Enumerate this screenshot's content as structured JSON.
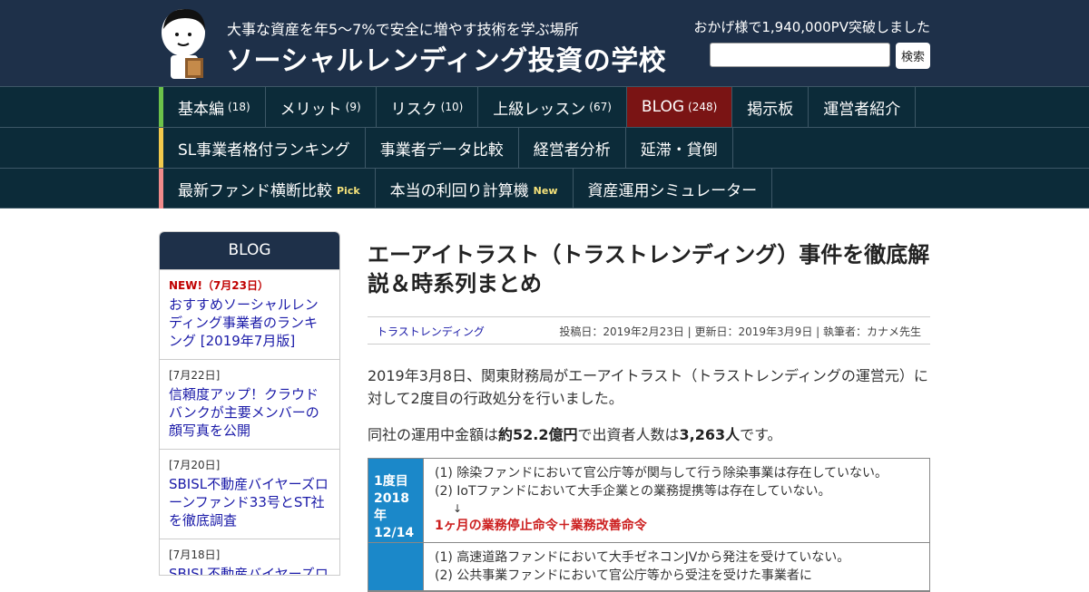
{
  "header": {
    "tagline": "大事な資産を年5～7%で安全に増やす技術を学ぶ場所",
    "site_title": "ソーシャルレンディング投資の学校",
    "pv_note": "おかげ様で1,940,000PV突破しました",
    "search_placeholder": "",
    "search_button": "検索",
    "mascot_icon": "teacher-mascot-icon"
  },
  "nav": {
    "row1": [
      {
        "label": "基本編",
        "count": "(18)"
      },
      {
        "label": "メリット",
        "count": "(9)"
      },
      {
        "label": "リスク",
        "count": "(10)"
      },
      {
        "label": "上級レッスン",
        "count": "(67)"
      },
      {
        "label": "BLOG",
        "count": "(248)",
        "active": true
      },
      {
        "label": "掲示板",
        "count": ""
      },
      {
        "label": "運営者紹介",
        "count": ""
      }
    ],
    "row2": [
      {
        "label": "SL事業者格付ランキング"
      },
      {
        "label": "事業者データ比較"
      },
      {
        "label": "経営者分析"
      },
      {
        "label": "延滞・貸倒"
      }
    ],
    "row3": [
      {
        "label": "最新ファンド横断比較",
        "badge": "Pick"
      },
      {
        "label": "本当の利回り計算機",
        "badge": "New"
      },
      {
        "label": "資産運用シミュレーター",
        "badge": ""
      }
    ],
    "strip_colors": [
      "#6cc24a",
      "#f2c94c",
      "#f08a8a"
    ],
    "active_color": "#7a1414"
  },
  "sidebar": {
    "title": "BLOG",
    "posts": [
      {
        "date": "NEW!（7月23日）",
        "title": "おすすめソーシャルレンディング事業者のランキング [2019年7月版]",
        "is_new": true
      },
      {
        "date": "[7月22日]",
        "title": "信頼度アップ！クラウドバンクが主要メンバーの顔写真を公開"
      },
      {
        "date": "[7月20日]",
        "title": "SBISL不動産バイヤーズローンファンド33号とST社を徹底調査"
      },
      {
        "date": "[7月18日]",
        "title": "SBISL不動産バイヤーズローンファンド"
      }
    ]
  },
  "article": {
    "title": "エーアイトラスト（トラストレンディング）事件を徹底解説＆時系列まとめ",
    "category": "トラストレンディング",
    "meta": "投稿日：2019年2月23日 | 更新日：2019年3月9日 | 執筆者：カナメ先生",
    "para1": "2019年3月8日、関東財務局がエーアイトラスト（トラストレンディングの運営元）に対して2度目の行政処分を行いました。",
    "para2_pre": "同社の運用中金額は",
    "para2_amount": "約52.2億円",
    "para2_mid": "で出資者人数は",
    "para2_people": "3,263人",
    "para2_post": "です。",
    "timeline": [
      {
        "head": "1度目 2018年 12/14",
        "lines": [
          "(1) 除染ファンドにおいて官公庁等が関与して行う除染事業は存在していない。",
          "(2) IoTファンドにおいて大手企業との業務提携等は存在していない。"
        ],
        "arrow": "↓",
        "result": "1ヶ月の業務停止命令＋業務改善命令"
      },
      {
        "head": "",
        "lines": [
          "(1) 高速道路ファンドにおいて大手ゼネコンJVから発注を受けていない。",
          "(2) 公共事業ファンドにおいて官公庁等から受注を受けた事業者に"
        ],
        "arrow": "",
        "result": ""
      }
    ],
    "timeline_head_color": "#1b88c9"
  }
}
